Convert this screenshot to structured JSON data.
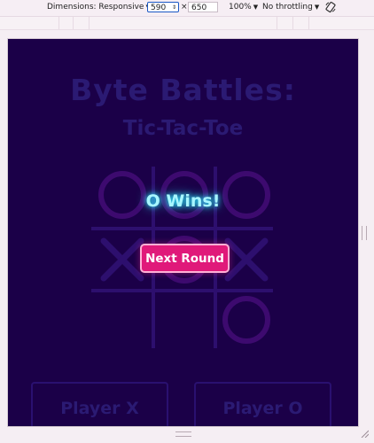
{
  "devtools": {
    "dimensions_label": "Dimensions: Responsive",
    "width_value": "590",
    "times": "×",
    "height_value": "650",
    "zoom_label": "100%",
    "throttling_label": "No throttling"
  },
  "game": {
    "title": "Byte Battles:",
    "subtitle": "Tic-Tac-Toe",
    "board": [
      "O",
      "",
      "O",
      "X",
      "O",
      "X",
      "",
      "",
      "O"
    ],
    "result_message": "O Wins!",
    "next_round_label": "Next Round",
    "player_x_label": "Player X",
    "player_o_label": "Player O"
  },
  "colors": {
    "background": "#1b0048",
    "dimmed_mark": "#2d0f6e",
    "o_mark": "#3d0a6f",
    "accent_pink": "#e0197a",
    "message_cyan": "#a8f6ff"
  }
}
